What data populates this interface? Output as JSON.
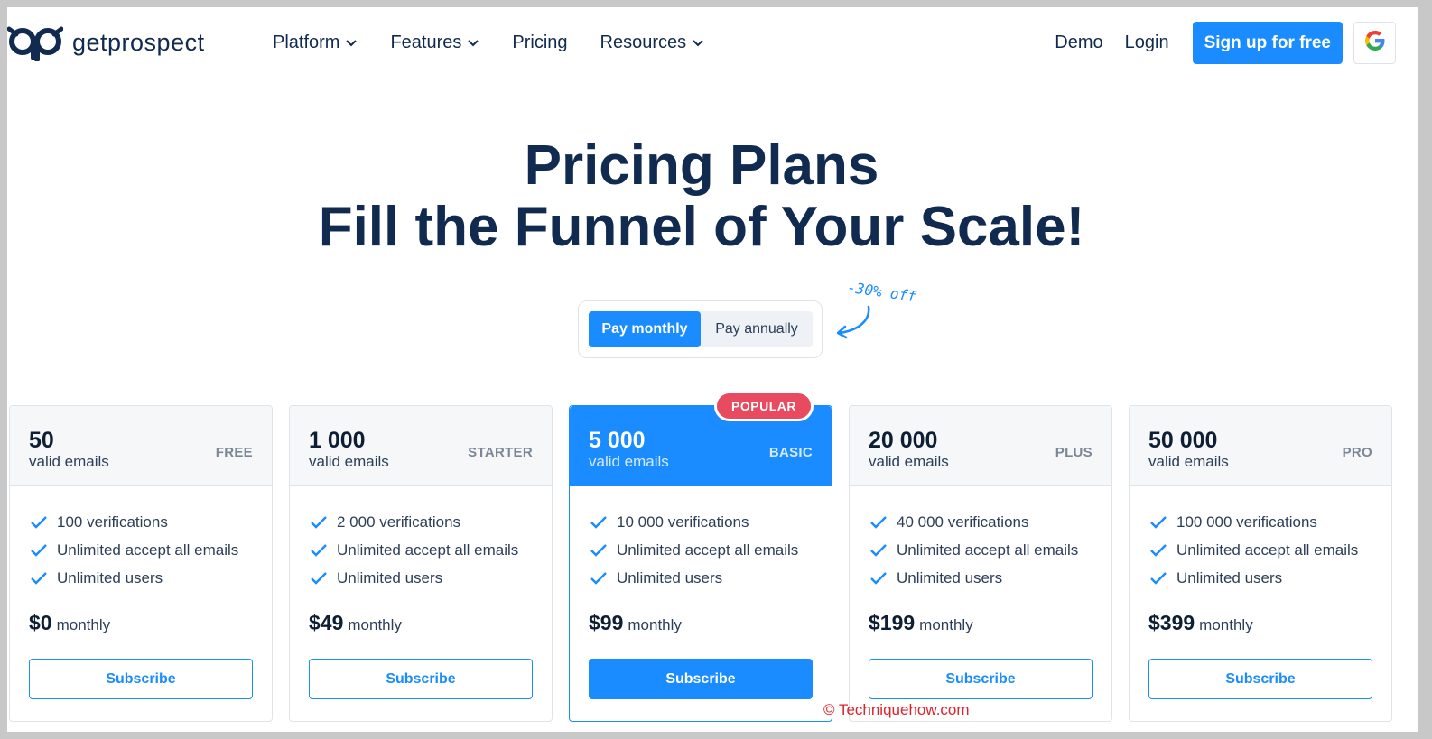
{
  "header": {
    "logo_text": "getprospect",
    "nav": [
      {
        "label": "Platform",
        "has_dropdown": true
      },
      {
        "label": "Features",
        "has_dropdown": true
      },
      {
        "label": "Pricing",
        "has_dropdown": false
      },
      {
        "label": "Resources",
        "has_dropdown": true
      }
    ],
    "demo_label": "Demo",
    "login_label": "Login",
    "signup_label": "Sign up for free",
    "google_icon": "google-icon"
  },
  "hero": {
    "title_line1": "Pricing Plans",
    "title_line2": "Fill the Funnel of Your Scale!"
  },
  "billing": {
    "monthly_label": "Pay monthly",
    "annual_label": "Pay annually",
    "selected": "monthly",
    "discount_note": "-30% off"
  },
  "plans": [
    {
      "amount": "50",
      "unit": "valid emails",
      "tier": "FREE",
      "features": [
        "100 verifications",
        "Unlimited accept all emails",
        "Unlimited users"
      ],
      "price": "$0",
      "period": "monthly",
      "button": "Subscribe",
      "popular": false
    },
    {
      "amount": "1 000",
      "unit": "valid emails",
      "tier": "STARTER",
      "features": [
        "2 000 verifications",
        "Unlimited accept all emails",
        "Unlimited users"
      ],
      "price": "$49",
      "period": "monthly",
      "button": "Subscribe",
      "popular": false
    },
    {
      "amount": "5 000",
      "unit": "valid emails",
      "tier": "BASIC",
      "features": [
        "10 000 verifications",
        "Unlimited accept all emails",
        "Unlimited users"
      ],
      "price": "$99",
      "period": "monthly",
      "button": "Subscribe",
      "popular": true,
      "badge": "POPULAR"
    },
    {
      "amount": "20 000",
      "unit": "valid emails",
      "tier": "PLUS",
      "features": [
        "40 000 verifications",
        "Unlimited accept all emails",
        "Unlimited users"
      ],
      "price": "$199",
      "period": "monthly",
      "button": "Subscribe",
      "popular": false
    },
    {
      "amount": "50 000",
      "unit": "valid emails",
      "tier": "PRO",
      "features": [
        "100 000 verifications",
        "Unlimited accept all emails",
        "Unlimited users"
      ],
      "price": "$399",
      "period": "monthly",
      "button": "Subscribe",
      "popular": false
    }
  ],
  "watermark": "© Techniquehow.com",
  "colors": {
    "primary": "#1a8cff",
    "navy": "#112a4f",
    "badge": "#e84a5f",
    "watermark": "#e0222b"
  }
}
